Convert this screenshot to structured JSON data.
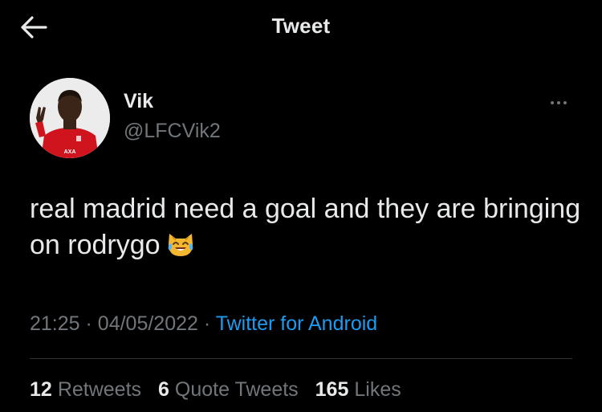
{
  "header": {
    "title": "Tweet",
    "back_icon": "arrow-left-icon"
  },
  "author": {
    "name": "Vik",
    "handle": "@LFCVik2",
    "avatar_icon": "profile-photo"
  },
  "tweet": {
    "text": "real madrid need a goal and they are bringing on rodrygo",
    "emoji_icon": "crying-laughing-cat-emoji",
    "time": "21:25",
    "separator": "·",
    "date": "04/05/2022",
    "source": "Twitter for Android"
  },
  "stats": {
    "retweets_count": "12",
    "retweets_label": "Retweets",
    "quotes_count": "6",
    "quotes_label": "Quote Tweets",
    "likes_count": "165",
    "likes_label": "Likes"
  },
  "colors": {
    "background": "#000000",
    "primary_text": "#e7e9ea",
    "secondary_text": "#71767b",
    "link": "#1d9bf0",
    "divider": "#2f3336"
  }
}
